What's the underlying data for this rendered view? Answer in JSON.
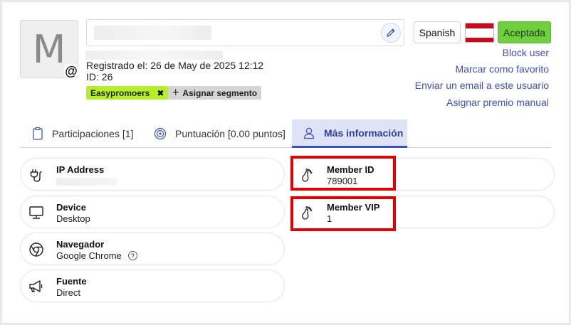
{
  "profile": {
    "avatar_letter": "M",
    "badge_symbol": "@",
    "registered": "Registrado el: 26 de May de 2025 12:12",
    "id_line": "ID: 26",
    "segment_tag": "Easypromoers",
    "segment_remove_symbol": "✖",
    "assign_segment_symbol": "+",
    "assign_segment_label": "Asignar segmento"
  },
  "header": {
    "language_label": "Spanish",
    "status_label": "Aceptada",
    "status_color": "#6fcf3c",
    "actions": [
      {
        "label": "Block user"
      },
      {
        "label": "Marcar como favorito"
      },
      {
        "label": "Enviar un email a este usuario"
      },
      {
        "label": "Asignar premio manual"
      }
    ]
  },
  "tabs": [
    {
      "label": "Participaciones [1]",
      "icon": "clipboard-icon"
    },
    {
      "label": "Puntuación [0.00 puntos]",
      "icon": "target-icon"
    },
    {
      "label": "Más información",
      "icon": "user-icon",
      "active": true
    }
  ],
  "info_left": [
    {
      "label": "IP Address",
      "value": "",
      "icon": "plug-icon"
    },
    {
      "label": "Device",
      "value": "Desktop",
      "icon": "monitor-icon"
    },
    {
      "label": "Navegador",
      "value": "Google Chrome",
      "icon": "chrome-icon",
      "help": "?"
    },
    {
      "label": "Fuente",
      "value": "Direct",
      "icon": "megaphone-icon"
    }
  ],
  "info_right": [
    {
      "label": "Member ID",
      "value": "789001",
      "icon": "footprint-icon"
    },
    {
      "label": "Member VIP",
      "value": "1",
      "icon": "footprint-icon"
    }
  ],
  "colors": {
    "accent": "#3f51b5",
    "active_tab_bg": "#dfe3f6",
    "segment_tag": "#b6ef2a",
    "highlight": "#e30000"
  }
}
